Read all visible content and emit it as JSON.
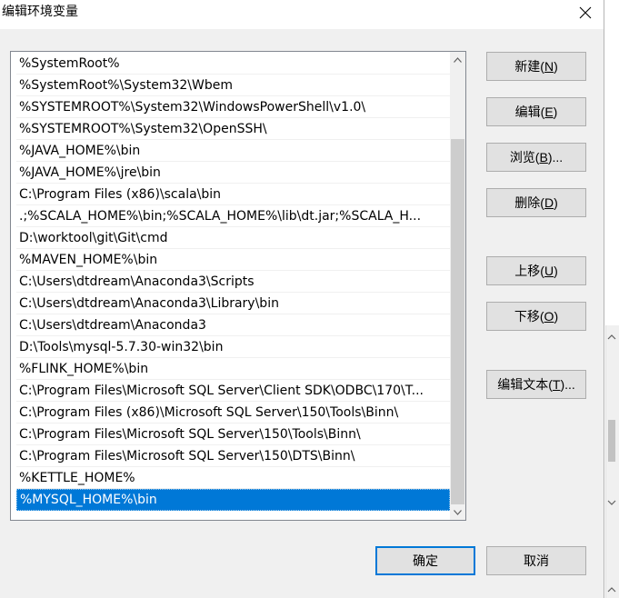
{
  "window": {
    "title": "编辑环境变量"
  },
  "list": {
    "items": [
      "%SystemRoot%",
      "%SystemRoot%\\System32\\Wbem",
      "%SYSTEMROOT%\\System32\\WindowsPowerShell\\v1.0\\",
      "%SYSTEMROOT%\\System32\\OpenSSH\\",
      "%JAVA_HOME%\\bin",
      "%JAVA_HOME%\\jre\\bin",
      "C:\\Program Files (x86)\\scala\\bin",
      ".;%SCALA_HOME%\\bin;%SCALA_HOME%\\lib\\dt.jar;%SCALA_H...",
      "D:\\worktool\\git\\Git\\cmd",
      "%MAVEN_HOME%\\bin",
      "C:\\Users\\dtdream\\Anaconda3\\Scripts",
      "C:\\Users\\dtdream\\Anaconda3\\Library\\bin",
      "C:\\Users\\dtdream\\Anaconda3",
      "D:\\Tools\\mysql-5.7.30-win32\\bin",
      "%FLINK_HOME%\\bin",
      "C:\\Program Files\\Microsoft SQL Server\\Client SDK\\ODBC\\170\\T...",
      "C:\\Program Files (x86)\\Microsoft SQL Server\\150\\Tools\\Binn\\",
      "C:\\Program Files\\Microsoft SQL Server\\150\\Tools\\Binn\\",
      "C:\\Program Files\\Microsoft SQL Server\\150\\DTS\\Binn\\",
      "%KETTLE_HOME%",
      "%MYSQL_HOME%\\bin"
    ],
    "selected_index": 20
  },
  "buttons": {
    "new": {
      "label": "新建(",
      "key": "N",
      "end": ")"
    },
    "edit": {
      "label": "编辑(",
      "key": "E",
      "end": ")"
    },
    "browse": {
      "label": "浏览(",
      "key": "B",
      "end": ")..."
    },
    "delete": {
      "label": "删除(",
      "key": "D",
      "end": ")"
    },
    "move_up": {
      "label": "上移(",
      "key": "U",
      "end": ")"
    },
    "move_down": {
      "label": "下移(",
      "key": "O",
      "end": ")"
    },
    "edit_text": {
      "label": "编辑文本(",
      "key": "T",
      "end": ")..."
    },
    "ok": {
      "label": "确定"
    },
    "cancel": {
      "label": "取消"
    }
  },
  "colors": {
    "selection": "#0078d7",
    "dialog_bg": "#f0f0f0",
    "button_bg": "#e1e1e1",
    "default_button_border": "#0078d7"
  },
  "icons": {
    "close": "close-icon",
    "scroll_up": "chevron-up-icon",
    "scroll_down": "chevron-down-icon"
  }
}
